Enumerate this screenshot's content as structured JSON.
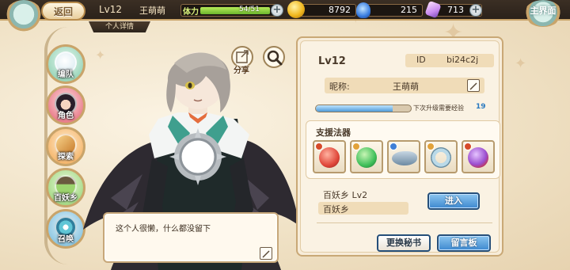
{
  "topbar": {
    "back_label": "返回",
    "level": "Lv12",
    "player_name": "王萌萌",
    "stamina_label": "体力",
    "stamina_value": "54/51",
    "stamina_fill_fraction": 1.0,
    "gold": "8792",
    "gems": "215",
    "crystals": "713",
    "main_label": "主界面",
    "subtab_label": "个人详情"
  },
  "nav": {
    "items": [
      {
        "label": "编队",
        "color": "#7fcaa9",
        "icon": "ghost-icon"
      },
      {
        "label": "角色",
        "color": "#e25b6c",
        "icon": "character-icon"
      },
      {
        "label": "探索",
        "color": "#f2a34a",
        "icon": "explore-icon"
      },
      {
        "label": "百妖乡",
        "color": "#8ecf6a",
        "icon": "village-icon"
      },
      {
        "label": "召唤",
        "color": "#6fb6d8",
        "icon": "summon-icon"
      }
    ]
  },
  "tools": {
    "share_label": "分享",
    "share_icon": "share-icon",
    "search_icon": "search-icon"
  },
  "signature": {
    "text": "这个人很懒，什么都没留下"
  },
  "profile": {
    "level": "Lv12",
    "id_label": "ID",
    "id_value": "bi24c2j",
    "nickname_label": "昵称:",
    "nickname_value": "王萌萌",
    "exp_fill_fraction": 0.81,
    "exp_text": "下次升级需要经验",
    "exp_value": "19",
    "support_title": "支援法器",
    "artifacts": [
      {
        "name": "red-gear-artifact-icon",
        "color": "#e0473a",
        "element": "#d64b2a"
      },
      {
        "name": "green-octopus-artifact-icon",
        "color": "#3fbf5a",
        "element": "#e2a23a"
      },
      {
        "name": "whale-artifact-icon",
        "color": "#8aa3b8",
        "element": "#3f7fd6"
      },
      {
        "name": "ring-artifact-icon",
        "color": "#b9d9e8",
        "element": "#e2a23a"
      },
      {
        "name": "purple-orb-artifact-icon",
        "color": "#9b4fd0",
        "element": "#d64b2a"
      }
    ],
    "village_label": "百妖乡  Lv2",
    "village_name": "百妖乡",
    "enter_label": "进入",
    "change_book_label": "更换秘书",
    "message_board_label": "留言板"
  }
}
